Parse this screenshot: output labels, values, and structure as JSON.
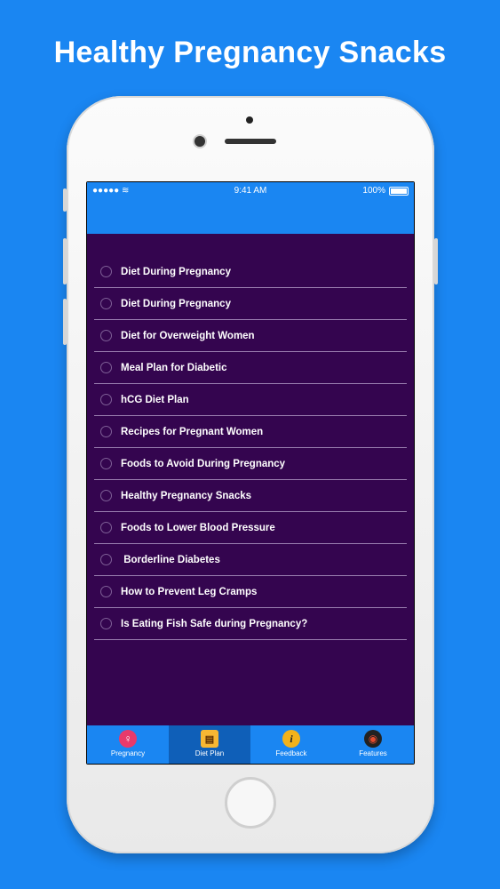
{
  "headline": "Healthy Pregnancy Snacks",
  "status_bar": {
    "signal": "●●●●● ≋",
    "time": "9:41 AM",
    "battery": "100%"
  },
  "menu": {
    "items": [
      {
        "label": "Diet During Pregnancy"
      },
      {
        "label": "Diet During Pregnancy"
      },
      {
        "label": "Diet for Overweight Women"
      },
      {
        "label": "Meal Plan for Diabetic"
      },
      {
        "label": "hCG Diet Plan"
      },
      {
        "label": "Recipes for Pregnant Women"
      },
      {
        "label": "Foods to Avoid During Pregnancy"
      },
      {
        "label": "Healthy Pregnancy Snacks"
      },
      {
        "label": "Foods to Lower Blood Pressure"
      },
      {
        "label": " Borderline Diabetes"
      },
      {
        "label": "How to Prevent Leg Cramps"
      },
      {
        "label": "Is Eating Fish Safe during Pregnancy?"
      }
    ]
  },
  "tabs": [
    {
      "label": "Pregnancy",
      "icon": "pregnancy-icon",
      "glyph": "♀"
    },
    {
      "label": "Diet Plan",
      "icon": "diet-plan-icon",
      "glyph": "▤"
    },
    {
      "label": "Feedback",
      "icon": "info-icon",
      "glyph": "i"
    },
    {
      "label": "Features",
      "icon": "features-icon",
      "glyph": "◉"
    }
  ],
  "colors": {
    "background": "#1a86f2",
    "list_background": "#34054f",
    "active_tab": "#0f5fb8"
  }
}
